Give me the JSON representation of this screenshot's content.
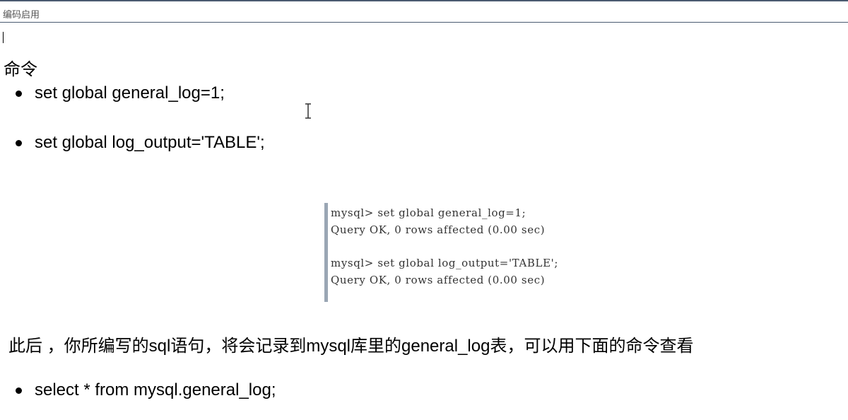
{
  "header": {
    "label": "编码启用"
  },
  "section": {
    "heading": "命令",
    "commands": [
      "set global general_log=1;",
      "set global log_output='TABLE';"
    ]
  },
  "terminal": {
    "lines": [
      "mysql> set global general_log=1;",
      "Query OK, 0 rows affected (0.00 sec)",
      "",
      "mysql> set global log_output='TABLE';",
      "Query OK, 0 rows affected (0.00 sec)"
    ]
  },
  "after": {
    "paragraph": "此后 ，你所编写的sql语句，将会记录到mysql库里的general_log表，可以用下面的命令查看",
    "commands": [
      "select * from mysql.general_log;"
    ]
  }
}
